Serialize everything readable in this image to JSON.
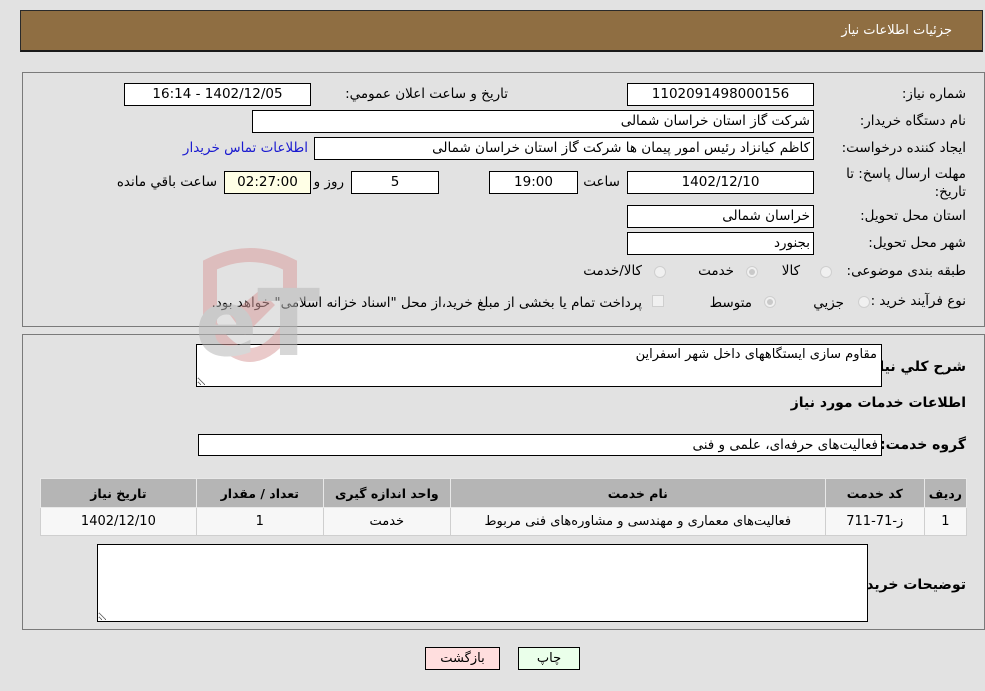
{
  "header": {
    "title": "جزئیات اطلاعات نیاز"
  },
  "form": {
    "need_number": {
      "label": "شماره نیاز:",
      "value": "1102091498000156"
    },
    "announce_datetime": {
      "label": "تاریخ و ساعت اعلان عمومي:",
      "value": "1402/12/05 - 16:14"
    },
    "buyer_org": {
      "label": "نام دستگاه خریدار:",
      "value": "شرکت گاز استان خراسان شمالی"
    },
    "requester": {
      "label": "ایجاد کننده درخواست:",
      "value": "کاظم کیانزاد رئیس امور پیمان ها شرکت گاز استان خراسان شمالی"
    },
    "buyer_contact_link": "اطلاعات تماس خریدار",
    "deadline": {
      "label_line1": "مهلت ارسال پاسخ: تا",
      "label_line2": "تاریخ:",
      "date": "1402/12/10",
      "time_label": "ساعت",
      "time": "19:00",
      "days": "5",
      "days_label": "روز و",
      "remaining": "02:27:00",
      "remaining_label": "ساعت باقي مانده"
    },
    "delivery_province": {
      "label": "استان محل تحویل:",
      "value": "خراسان شمالی"
    },
    "delivery_city": {
      "label": "شهر محل تحویل:",
      "value": "بجنورد"
    },
    "category": {
      "label": "طبقه بندی موضوعی:",
      "options": [
        "کالا",
        "خدمت",
        "کالا/خدمت"
      ],
      "selected": "خدمت"
    },
    "purchase_type": {
      "label": "نوع فرآیند خرید :",
      "options": [
        "جزیي",
        "متوسط"
      ],
      "selected": "متوسط",
      "treasury_note": "پرداخت تمام یا بخشی از مبلغ خرید،از محل \"اسناد خزانه اسلامی\" خواهد بود.",
      "treasury_checked": false
    }
  },
  "details": {
    "description_label": "شرح کلي نیاز:",
    "description": "مقاوم سازی ایستگاههای داخل شهر اسفراین",
    "services_heading": "اطلاعات خدمات مورد نیاز",
    "service_group_label": "گروه خدمت:",
    "service_group": "فعالیت‌های حرفه‌ای، علمی و فنی",
    "table": {
      "headers": [
        "ردیف",
        "کد خدمت",
        "نام خدمت",
        "واحد اندازه گیری",
        "تعداد / مقدار",
        "تاریخ نیاز"
      ],
      "rows": [
        [
          "1",
          "ز-71-711",
          "فعالیت‌های معماری و مهندسی و مشاوره‌های فنی مربوط",
          "خدمت",
          "1",
          "1402/12/10"
        ]
      ]
    },
    "buyer_notes_label": "توضیحات خریدار:",
    "buyer_notes": ""
  },
  "buttons": {
    "print": "چاپ",
    "back": "بازگشت"
  },
  "watermark": "AriaTender.neT",
  "colors": {
    "header_bg": "#8f6e42",
    "print_bg": "#eaffea",
    "back_bg": "#ffdede",
    "link": "#1a1ad0"
  }
}
